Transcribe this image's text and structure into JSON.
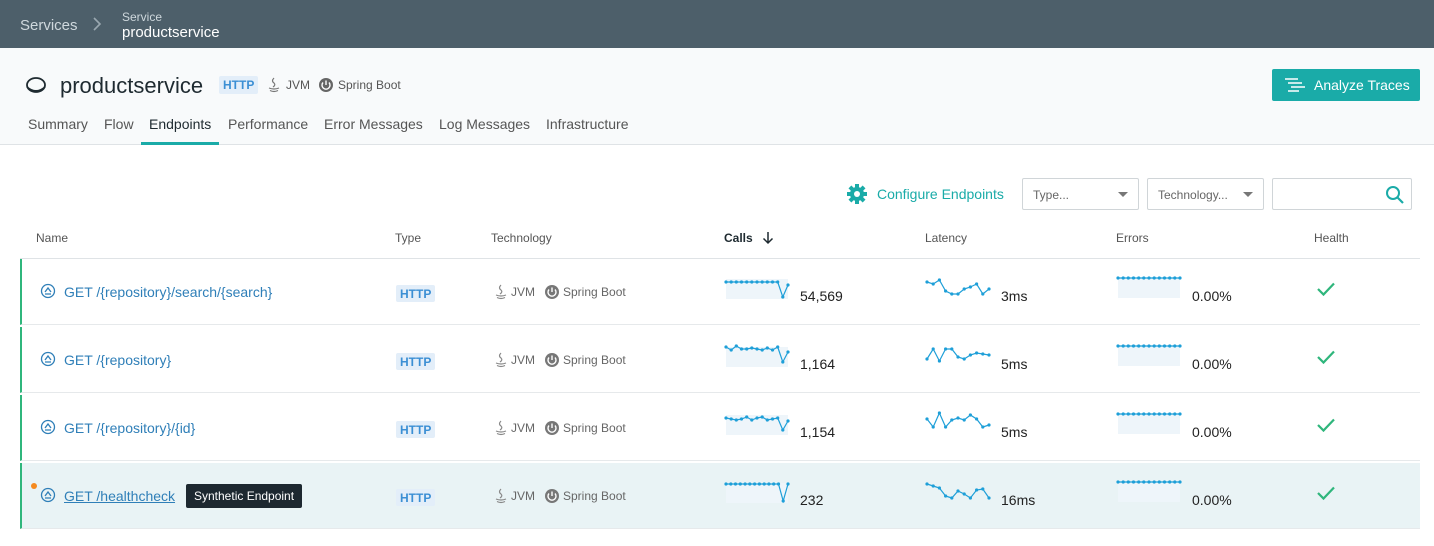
{
  "breadcrumb": {
    "services": "Services",
    "label": "Service",
    "current": "productservice"
  },
  "service": {
    "title": "productservice",
    "type_badge": "HTTP",
    "tech_jvm": "JVM",
    "tech_spring": "Spring Boot"
  },
  "actions": {
    "analyze": "Analyze Traces"
  },
  "tabs": [
    {
      "label": "Summary"
    },
    {
      "label": "Flow"
    },
    {
      "label": "Endpoints",
      "active": true
    },
    {
      "label": "Performance"
    },
    {
      "label": "Error Messages"
    },
    {
      "label": "Log Messages"
    },
    {
      "label": "Infrastructure"
    }
  ],
  "toolbar": {
    "configure": "Configure Endpoints",
    "type_placeholder": "Type...",
    "technology_placeholder": "Technology..."
  },
  "columns": {
    "name": "Name",
    "type": "Type",
    "technology": "Technology",
    "calls": "Calls",
    "latency": "Latency",
    "errors": "Errors",
    "health": "Health"
  },
  "rows": [
    {
      "name": "GET /{repository}/search/{search}",
      "type": "HTTP",
      "tech_jvm": "JVM",
      "tech_spring": "Spring Boot",
      "calls": "54,569",
      "latency": "3ms",
      "errors": "0.00%"
    },
    {
      "name": "GET /{repository}",
      "type": "HTTP",
      "tech_jvm": "JVM",
      "tech_spring": "Spring Boot",
      "calls": "1,164",
      "latency": "5ms",
      "errors": "0.00%"
    },
    {
      "name": "GET /{repository}/{id}",
      "type": "HTTP",
      "tech_jvm": "JVM",
      "tech_spring": "Spring Boot",
      "calls": "1,154",
      "latency": "5ms",
      "errors": "0.00%"
    },
    {
      "name": "GET /healthcheck",
      "type": "HTTP",
      "tech_jvm": "JVM",
      "tech_spring": "Spring Boot",
      "calls": "232",
      "latency": "16ms",
      "errors": "0.00%",
      "tooltip": "Synthetic Endpoint"
    }
  ],
  "colors": {
    "accent": "#1aaba8",
    "topbar": "#4d5f6a",
    "link": "#2f7fb8",
    "healthy": "#2fb67c",
    "warning_dot": "#f58a1f",
    "sparkline": "#1e9fd8"
  }
}
